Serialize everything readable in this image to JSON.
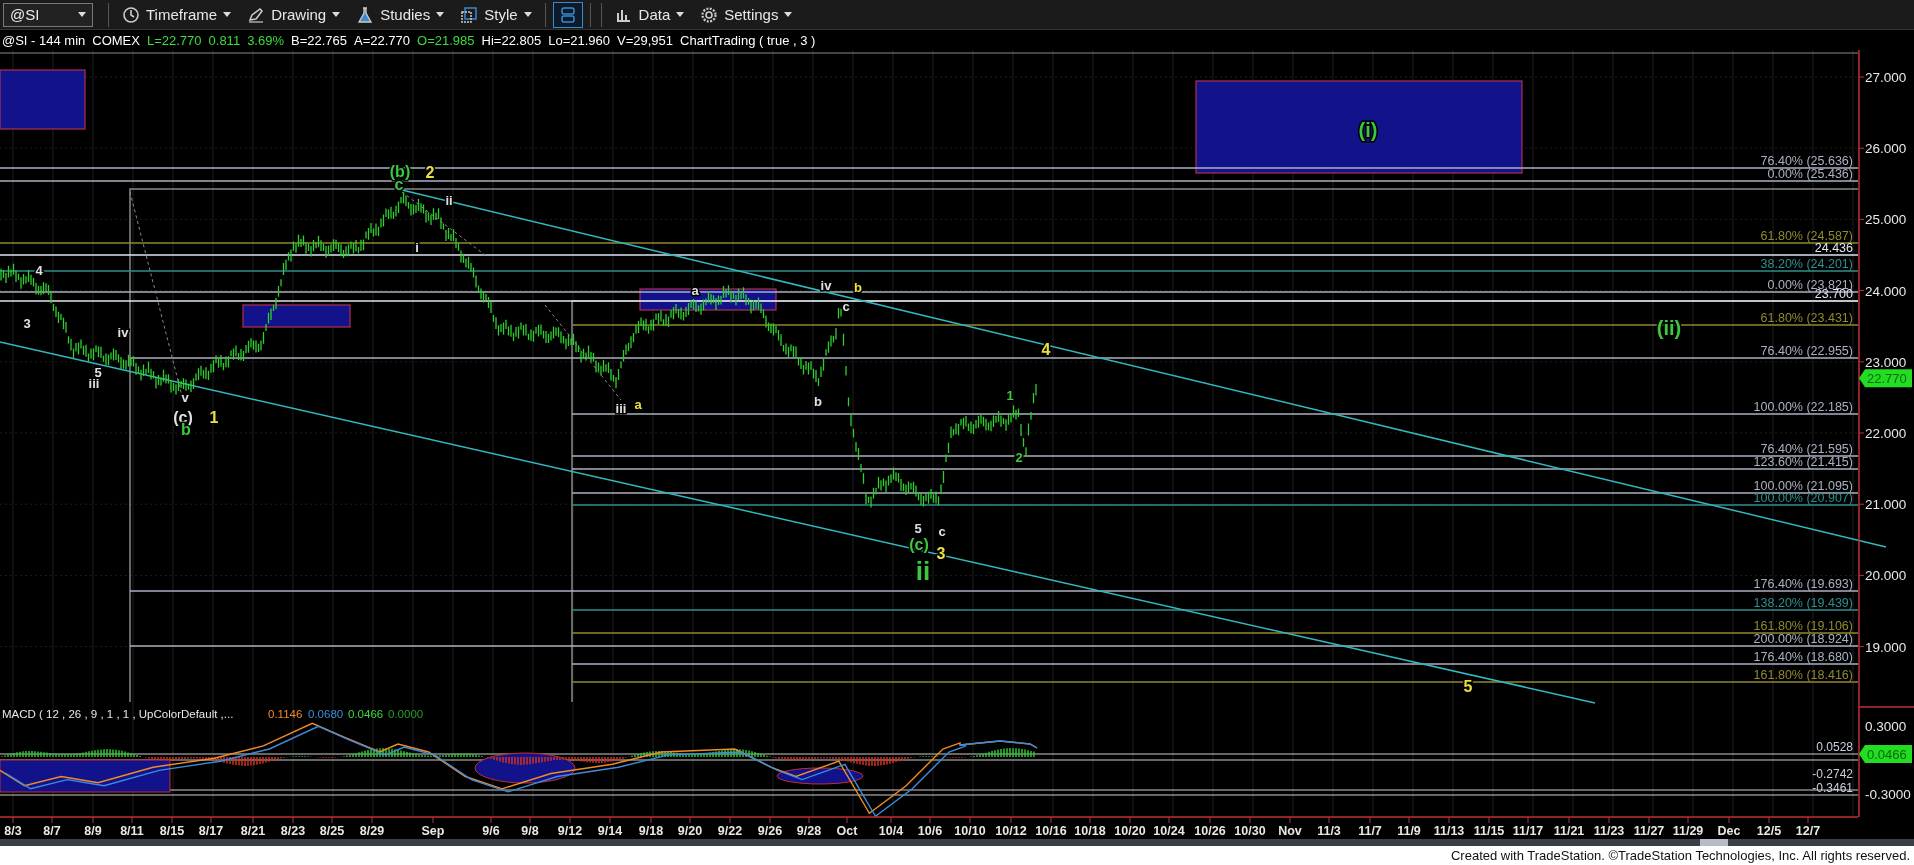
{
  "toolbar": {
    "symbol": "@SI",
    "menus": [
      {
        "kind": "timeframe",
        "label": "Timeframe"
      },
      {
        "kind": "drawing",
        "label": "Drawing"
      },
      {
        "kind": "studies",
        "label": "Studies"
      },
      {
        "kind": "style",
        "label": "Style"
      },
      {
        "kind": "layout",
        "on": true
      },
      {
        "kind": "data",
        "label": "Data"
      },
      {
        "kind": "settings",
        "label": "Settings"
      }
    ]
  },
  "info_line": [
    {
      "text": "@SI - 144 min",
      "color": "#ffffff"
    },
    {
      "text": "COMEX",
      "color": "#ffffff"
    },
    {
      "text": "L=22.770",
      "color": "#3cdc3c"
    },
    {
      "text": "0.811",
      "color": "#3cdc3c"
    },
    {
      "text": "3.69%",
      "color": "#3cdc3c"
    },
    {
      "text": "B=22.765",
      "color": "#ffffff"
    },
    {
      "text": "A=22.770",
      "color": "#ffffff"
    },
    {
      "text": "O=21.985",
      "color": "#3cdc3c"
    },
    {
      "text": "Hi=22.805",
      "color": "#ffffff"
    },
    {
      "text": "Lo=21.960",
      "color": "#ffffff"
    },
    {
      "text": "V=29,951",
      "color": "#ffffff"
    },
    {
      "text": "ChartTrading ( true , 3 )",
      "color": "#ffffff"
    }
  ],
  "price_chart": {
    "price_axis": [
      "27.000",
      "26.000",
      "25.000",
      "24.000",
      "23.000",
      "22.000",
      "21.000",
      "20.000",
      "19.000"
    ],
    "last_price": "22.770",
    "fib_levels": [
      {
        "text": "76.40% (25.636)",
        "color": "#a9b0c0"
      },
      {
        "text": "0.00% (25.436)",
        "color": "#a9b0c0"
      },
      {
        "text": "61.80% (24.587)",
        "color": "#8f8a2e"
      },
      {
        "text": "24.436",
        "color": "#dde6f0"
      },
      {
        "text": "38.20% (24.201)",
        "color": "#2f8f8f"
      },
      {
        "text": "0.00% (23.821)",
        "color": "#a9b0c0"
      },
      {
        "text": "23.700",
        "color": "#dde6f0"
      },
      {
        "text": "61.80% (23.431)",
        "color": "#8f8a2e"
      },
      {
        "text": "76.40% (22.955)",
        "color": "#a9b0c0"
      },
      {
        "text": "100.00% (22.185)",
        "color": "#a9b0c0"
      },
      {
        "text": "76.40% (21.595)",
        "color": "#a9b0c0"
      },
      {
        "text": "123.60% (21.415)",
        "color": "#a9b0c0"
      },
      {
        "text": "100.00% (21.095)",
        "color": "#a9b0c0"
      },
      {
        "text": "100.00% (20.907)",
        "color": "#2f8f8f"
      },
      {
        "text": "176.40% (19.693)",
        "color": "#a9b0c0"
      },
      {
        "text": "138.20% (19.439)",
        "color": "#2f8f8f"
      },
      {
        "text": "161.80% (19.106)",
        "color": "#8f8a2e"
      },
      {
        "text": "200.00% (18.924)",
        "color": "#a9b0c0"
      },
      {
        "text": "176.40% (18.680)",
        "color": "#a9b0c0"
      },
      {
        "text": "161.80% (18.416)",
        "color": "#8f8a2e"
      }
    ],
    "wave_labels": [
      {
        "text": "(i)",
        "color": "#3cc83c",
        "kind": "large"
      },
      {
        "text": "(ii)",
        "color": "#3cc83c",
        "kind": "large"
      },
      {
        "text": "4",
        "color": "#e8e040",
        "kind": "medium"
      },
      {
        "text": "5",
        "color": "#e8e040",
        "kind": "medium"
      },
      {
        "text": "(b)",
        "color": "#3cc83c",
        "kind": "medium"
      },
      {
        "text": "2",
        "color": "#e8e040",
        "kind": "medium"
      },
      {
        "text": "c",
        "color": "#3cc83c",
        "kind": "medium"
      },
      {
        "text": "ii",
        "color": "#e0e0e0",
        "kind": "small"
      },
      {
        "text": "i",
        "color": "#e0e0e0",
        "kind": "small"
      },
      {
        "text": "4",
        "color": "#e0e0e0",
        "kind": "small"
      },
      {
        "text": "3",
        "color": "#e0e0e0",
        "kind": "small"
      },
      {
        "text": "iv",
        "color": "#e0e0e0",
        "kind": "small"
      },
      {
        "text": "5",
        "color": "#e0e0e0",
        "kind": "small"
      },
      {
        "text": "iii",
        "color": "#e0e0e0",
        "kind": "small"
      },
      {
        "text": "v",
        "color": "#e0e0e0",
        "kind": "small"
      },
      {
        "text": "(c)",
        "color": "#e0e0e0",
        "kind": "medium"
      },
      {
        "text": "b",
        "color": "#3cc83c",
        "kind": "medium"
      },
      {
        "text": "1",
        "color": "#e8e040",
        "kind": "medium"
      },
      {
        "text": "a",
        "color": "#e0e0e0",
        "kind": "small"
      },
      {
        "text": "iv",
        "color": "#e0e0e0",
        "kind": "small"
      },
      {
        "text": "c",
        "color": "#e0e0e0",
        "kind": "small"
      },
      {
        "text": "b",
        "color": "#e8e040",
        "kind": "small"
      },
      {
        "text": "iii",
        "color": "#e0e0e0",
        "kind": "small"
      },
      {
        "text": "a",
        "color": "#e8e040",
        "kind": "small"
      },
      {
        "text": "b",
        "color": "#e0e0e0",
        "kind": "small"
      },
      {
        "text": "1",
        "color": "#3cc83c",
        "kind": "small"
      },
      {
        "text": "2",
        "color": "#3cc83c",
        "kind": "small"
      },
      {
        "text": "5",
        "color": "#e0e0e0",
        "kind": "small"
      },
      {
        "text": "c",
        "color": "#e0e0e0",
        "kind": "small"
      },
      {
        "text": "(c)",
        "color": "#3cc83c",
        "kind": "medium"
      },
      {
        "text": "3",
        "color": "#e8e040",
        "kind": "medium"
      },
      {
        "text": "ii",
        "color": "#3cc83c",
        "kind": "huge"
      }
    ],
    "date_axis": [
      "8/3",
      "8/7",
      "8/9",
      "8/11",
      "8/15",
      "8/17",
      "8/21",
      "8/23",
      "8/25",
      "8/29",
      "Sep",
      "9/6",
      "9/8",
      "9/12",
      "9/14",
      "9/18",
      "9/20",
      "9/22",
      "9/26",
      "9/28",
      "Oct",
      "10/4",
      "10/6",
      "10/10",
      "10/12",
      "10/16",
      "10/18",
      "10/20",
      "10/24",
      "10/26",
      "10/30",
      "Nov",
      "11/3",
      "11/7",
      "11/9",
      "11/13",
      "11/15",
      "11/17",
      "11/21",
      "11/23",
      "11/27",
      "11/29",
      "Dec",
      "12/5",
      "12/7"
    ]
  },
  "macd": {
    "title": "MACD ( 12 , 26 , 9 , 1 , 1 , UpColorDefault ,...",
    "values": [
      {
        "text": "0.1146",
        "color": "#f08c28"
      },
      {
        "text": "0.0680",
        "color": "#3c8cdc"
      },
      {
        "text": "0.0466",
        "color": "#3cdc3c"
      },
      {
        "text": "0.0000",
        "color": "#2a9a2a"
      }
    ],
    "axis": [
      "0.3000",
      "-0.3000"
    ],
    "level_labels": [
      "0.0528",
      "-0.2742",
      "-0.3461"
    ],
    "last_value": "0.0466"
  },
  "footer": "Created with TradeStation. ©TradeStation Technologies, Inc. All rights reserved."
}
